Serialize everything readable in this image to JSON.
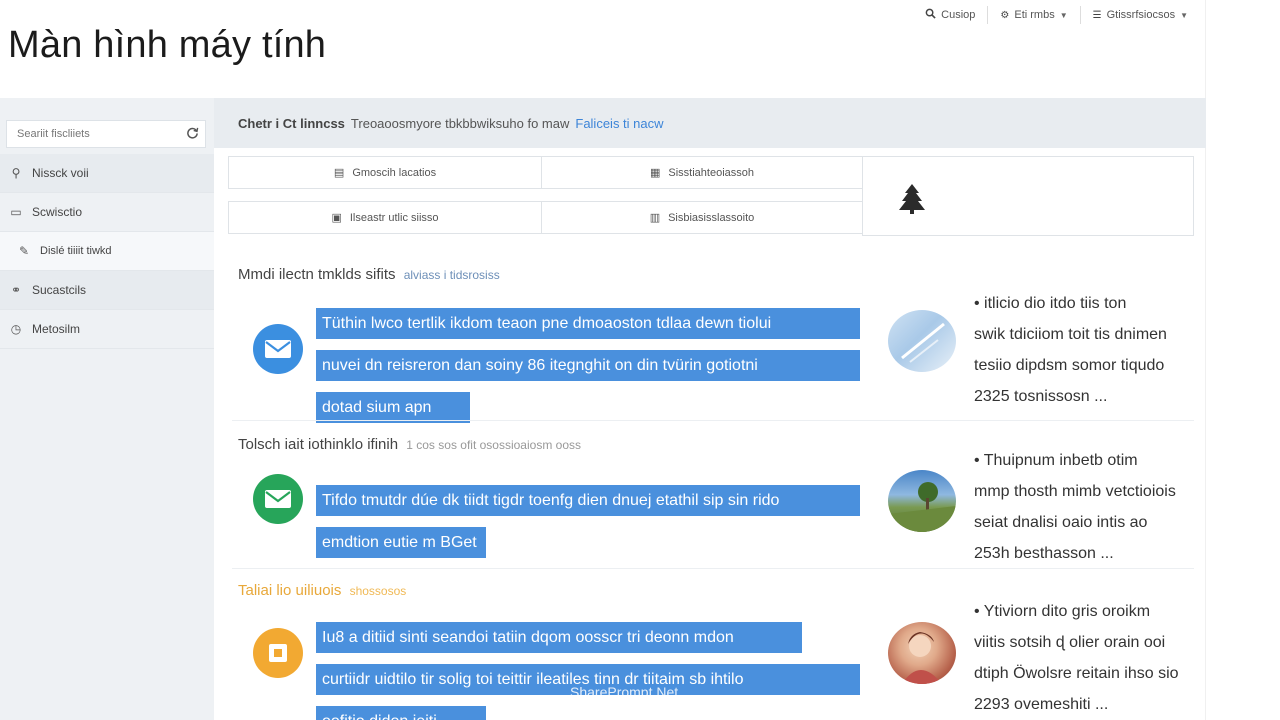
{
  "top_bar": {
    "items": [
      {
        "icon": "search-icon",
        "label": "Cusiop"
      },
      {
        "icon": "settings-icon",
        "label": "Eti rmbs"
      },
      {
        "icon": "profile-icon",
        "label": "Gtissrfsiocsos"
      }
    ]
  },
  "page_title": "Màn hình máy tính",
  "sidebar": {
    "search_placeholder": "Seariit fiscliiets",
    "items": [
      {
        "icon": "user-icon",
        "label": "Nissck voii"
      },
      {
        "icon": "folder-icon",
        "label": "Scwisctio"
      },
      {
        "icon": "edit-icon",
        "label": "Dislé tiiiit tiwkd"
      },
      {
        "icon": "group-icon",
        "label": "Sucastcils"
      },
      {
        "icon": "chat-icon",
        "label": "Metosilm"
      }
    ]
  },
  "main_header": {
    "label": "Chetr i Ct linncss",
    "desc": "Treoaoosmyore tbkbbwiksuho fo maw",
    "link": "Faliceis ti nacw"
  },
  "grid": {
    "cells": [
      {
        "icon": "document-icon",
        "label": "Gmoscih lacatios"
      },
      {
        "icon": "calendar-icon",
        "label": "Sisstiahteoiassoh"
      },
      {
        "icon": "image-icon",
        "label": "Ilseastr utlic siisso"
      },
      {
        "icon": "archive-icon",
        "label": "Sisbiasisslassoito"
      }
    ],
    "side_icon": "tree-icon"
  },
  "sections": [
    {
      "heading": "Mmdi ilectn tmklds sifits",
      "subheading": "alviass i tidsrosiss",
      "icon_color": "#3b8fe0",
      "lines": [
        "Tüthin lwco tertlik ikdom teaon pne dmoaoston tdlaa dewn tiolui",
        "nuvei dn reisreron dan soiny 86 itegnghit on din tvürin gotiotni",
        "dotad sium apn"
      ],
      "snippet": [
        "• itlicio dio itdo tiis ton",
        "swik tdiciiom toit tis dnimen",
        "tesiio dipdsm somor tiqudo",
        "2325 tosnissosn ..."
      ]
    },
    {
      "heading": "Tolsch iait iothinklo ifinih",
      "subheading": "1 cos sos ofit osossioaiosm ooss",
      "icon_color": "#27a55a",
      "lines": [
        "Tifdo tmutdr dúe dk tiidt tigdr toenfg dien dnuej etathil sip sin rido",
        "emdtion eutie m BGet"
      ],
      "snippet": [
        "• Thuipnum inbetb otim",
        "mmp thosth mimb vetctioiois",
        "seiat dnalisi oaio intis ao",
        "253h besthasson ..."
      ]
    },
    {
      "heading": "Taliai lio uiliuois",
      "subheading": "shossosos",
      "icon_color": "#f2a932",
      "lines": [
        "Iu8 a ditiid sinti seandoi tatiin dqom oosscr tri deonn mdon",
        "curtiidr uidtilo tir solig toi teittir ileatiles tinn dr tiitaim sb ihtilo",
        "oofitio didon ieiti"
      ],
      "snippet": [
        "• Ytiviorn dito gris oroikm",
        "viitis sotsih ɖ olier orain ooi",
        "dtiph Öwolsre reitain ihso sio",
        "2293 ovemeshiti ..."
      ]
    }
  ],
  "watermark": "SharePrompt.Net"
}
